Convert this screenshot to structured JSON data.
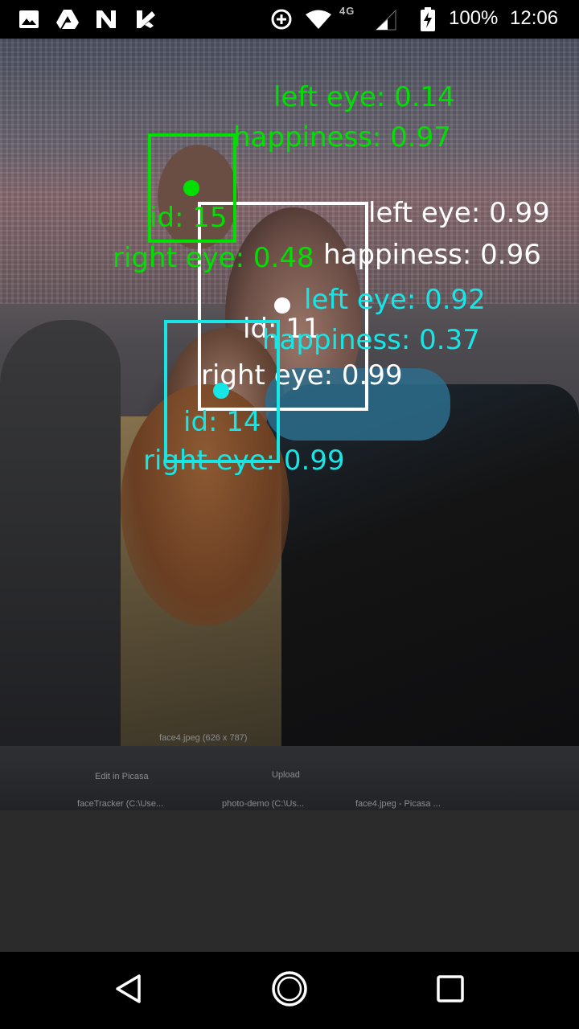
{
  "status_bar": {
    "notification_icons": [
      "image-icon",
      "drive-icon",
      "n-icon",
      "task-check-icon"
    ],
    "network_label": "4G",
    "battery_text": "100%",
    "time": "12:06"
  },
  "overlay": {
    "colors": {
      "green": "#00e000",
      "white": "#ffffff",
      "cyan": "#16e6e6"
    },
    "faces": [
      {
        "color": "green",
        "id_label": "id: 15",
        "left_eye": "left eye: 0.14",
        "happiness": "happiness: 0.97",
        "right_eye": "right eye: 0.48"
      },
      {
        "color": "white",
        "id_label": "id: 11",
        "left_eye": "left eye: 0.99",
        "happiness": "happiness: 0.96",
        "right_eye": "right eye: 0.99"
      },
      {
        "color": "cyan",
        "id_label": "id: 14",
        "left_eye": "left eye: 0.92",
        "happiness": "happiness: 0.37",
        "right_eye": "right eye: 0.99"
      }
    ]
  },
  "background_screen": {
    "caption": "face4.jpeg (626 x 787)",
    "toolbar_label": "Edit in Picasa",
    "upload_label": "Upload",
    "taskbar_items": [
      "faceTracker (C:\\Use...",
      "photo-demo (C:\\Us...",
      "face4.jpeg - Picasa ..."
    ]
  },
  "nav_bar": {
    "back_icon": "back-triangle-icon",
    "home_icon": "home-circle-icon",
    "recents_icon": "recents-square-icon"
  }
}
